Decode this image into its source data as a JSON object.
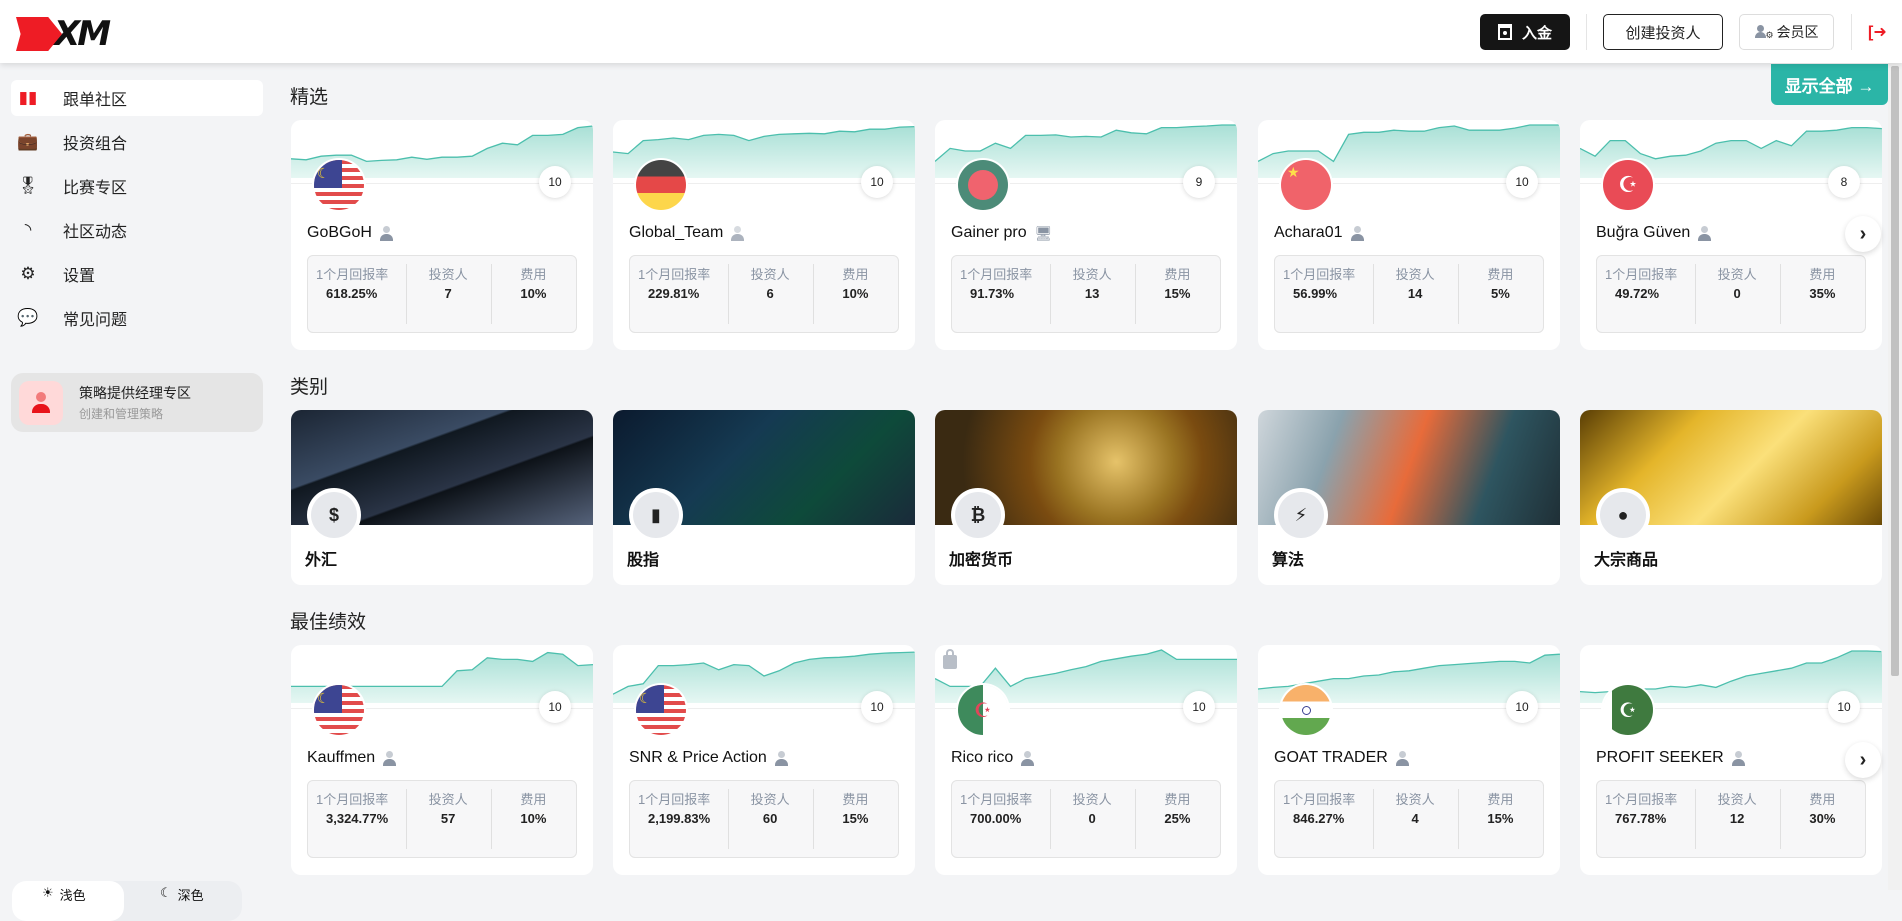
{
  "header": {
    "logo_text": "XM",
    "deposit_label": "入金",
    "create_investor_label": "创建投资人",
    "member_area_label": "会员区",
    "logout_icon": "logout-icon"
  },
  "sidebar": {
    "items": [
      {
        "label": "跟单社区",
        "icon": "bar-chart-icon",
        "active": true
      },
      {
        "label": "投资组合",
        "icon": "briefcase-icon",
        "active": false
      },
      {
        "label": "比赛专区",
        "icon": "award-icon",
        "active": false
      },
      {
        "label": "社区动态",
        "icon": "rss-icon",
        "active": false
      },
      {
        "label": "设置",
        "icon": "gear-icon",
        "active": false
      },
      {
        "label": "常见问题",
        "icon": "faq-icon",
        "active": false
      }
    ],
    "manager": {
      "title": "策略提供经理专区",
      "subtitle": "创建和管理策略"
    },
    "theme": {
      "light": "浅色",
      "dark": "深色"
    }
  },
  "sections": {
    "featured_title": "精选",
    "show_all_label": "显示全部 →",
    "categories_title": "类别",
    "best_title": "最佳绩效"
  },
  "stat_labels": {
    "return": "1个月回报率",
    "investors": "投资人",
    "fee": "费用"
  },
  "featured": [
    {
      "name": "GoBGoH",
      "flag": "malaysia",
      "score": "10",
      "type_icon": "person-icon",
      "return": "618.25%",
      "investors": "7",
      "fee": "10%",
      "spark": [
        0.35,
        0.33,
        0.4,
        0.42,
        0.42,
        0.3,
        0.32,
        0.33,
        0.38,
        0.34,
        0.38,
        0.38,
        0.4,
        0.55,
        0.65,
        0.62,
        0.8,
        0.8,
        0.82,
        0.95,
        0.98
      ]
    },
    {
      "name": "Global_Team",
      "flag": "germany",
      "score": "10",
      "type_icon": "manager-icon",
      "return": "229.81%",
      "investors": "6",
      "fee": "10%",
      "spark": [
        0.48,
        0.45,
        0.7,
        0.72,
        0.75,
        0.72,
        0.8,
        0.82,
        0.8,
        0.7,
        0.78,
        0.82,
        0.83,
        0.84,
        0.83,
        0.88,
        0.87,
        0.92,
        0.92,
        0.96,
        0.97
      ]
    },
    {
      "name": "Gainer pro",
      "flag": "bangladesh",
      "score": "9",
      "type_icon": "desktop-icon",
      "return": "91.73%",
      "investors": "13",
      "fee": "15%",
      "spark": [
        0.3,
        0.55,
        0.5,
        0.5,
        0.65,
        0.55,
        0.8,
        0.8,
        0.81,
        0.77,
        0.78,
        0.77,
        0.9,
        0.85,
        0.83,
        0.95,
        0.95,
        0.97,
        0.98,
        1.0,
        1.0
      ]
    },
    {
      "name": "Achara01",
      "flag": "china",
      "score": "10",
      "type_icon": "person-icon",
      "return": "56.99%",
      "investors": "14",
      "fee": "5%",
      "spark": [
        0.3,
        0.45,
        0.5,
        0.5,
        0.5,
        0.3,
        0.82,
        0.86,
        0.86,
        0.9,
        0.88,
        0.88,
        0.95,
        0.98,
        0.9,
        0.9,
        0.9,
        0.94,
        1.0,
        1.0,
        1.0
      ]
    },
    {
      "name": "Buğra Güven",
      "flag": "turkey",
      "score": "8",
      "type_icon": "person-icon",
      "return": "49.72%",
      "investors": "0",
      "fee": "35%",
      "spark": [
        0.55,
        0.4,
        0.7,
        0.7,
        0.45,
        0.35,
        0.4,
        0.42,
        0.5,
        0.65,
        0.7,
        0.7,
        0.55,
        0.7,
        0.6,
        0.88,
        0.88,
        0.9,
        0.95,
        0.95,
        0.93
      ]
    }
  ],
  "categories": [
    {
      "label": "外汇",
      "icon": "dollar-icon",
      "glyph": "$"
    },
    {
      "label": "股指",
      "icon": "bar-chart-icon",
      "glyph": "▮"
    },
    {
      "label": "加密货币",
      "icon": "bitcoin-icon",
      "glyph": "₿"
    },
    {
      "label": "算法",
      "icon": "lightning-icon",
      "glyph": "⚡"
    },
    {
      "label": "大宗商品",
      "icon": "drop-icon",
      "glyph": "💧"
    }
  ],
  "best": [
    {
      "name": "Kauffmen",
      "flag": "malaysia",
      "score": "10",
      "type_icon": "person-icon",
      "locked": false,
      "return": "3,324.77%",
      "investors": "57",
      "fee": "10%",
      "spark": [
        0.3,
        0.3,
        0.3,
        0.3,
        0.3,
        0.3,
        0.3,
        0.3,
        0.3,
        0.3,
        0.3,
        0.6,
        0.62,
        0.85,
        0.82,
        0.82,
        0.78,
        0.95,
        0.92,
        0.7,
        0.72
      ]
    },
    {
      "name": "SNR & Price Action",
      "flag": "malaysia",
      "score": "10",
      "type_icon": "person-icon",
      "locked": false,
      "return": "2,199.83%",
      "investors": "60",
      "fee": "15%",
      "spark": [
        0.15,
        0.3,
        0.35,
        0.7,
        0.7,
        0.72,
        0.75,
        0.62,
        0.72,
        0.7,
        0.5,
        0.6,
        0.75,
        0.82,
        0.85,
        0.86,
        0.88,
        0.92,
        0.94,
        0.95,
        0.96
      ]
    },
    {
      "name": "Rico rico",
      "flag": "algeria",
      "score": "10",
      "type_icon": "person-icon",
      "locked": true,
      "return": "700.00%",
      "investors": "0",
      "fee": "25%",
      "spark": [
        0.45,
        0.3,
        0.3,
        0.3,
        0.65,
        0.3,
        0.45,
        0.5,
        0.55,
        0.62,
        0.68,
        0.78,
        0.83,
        0.88,
        0.92,
        1.0,
        0.82,
        0.82,
        0.82,
        0.82,
        0.82
      ]
    },
    {
      "name": "GOAT TRADER",
      "flag": "india",
      "score": "10",
      "type_icon": "person-icon",
      "locked": false,
      "return": "846.27%",
      "investors": "4",
      "fee": "15%",
      "spark": [
        0.25,
        0.28,
        0.3,
        0.35,
        0.4,
        0.45,
        0.45,
        0.5,
        0.52,
        0.58,
        0.6,
        0.65,
        0.7,
        0.72,
        0.74,
        0.76,
        0.78,
        0.78,
        0.75,
        0.9,
        0.92
      ]
    },
    {
      "name": "PROFIT SEEKER",
      "flag": "pakistan",
      "score": "10",
      "type_icon": "person-icon",
      "locked": false,
      "return": "767.78%",
      "investors": "12",
      "fee": "30%",
      "spark": [
        0.2,
        0.18,
        0.2,
        0.22,
        0.25,
        0.25,
        0.3,
        0.28,
        0.33,
        0.28,
        0.4,
        0.5,
        0.55,
        0.6,
        0.65,
        0.75,
        0.75,
        0.85,
        0.98,
        0.98,
        0.97
      ]
    }
  ]
}
